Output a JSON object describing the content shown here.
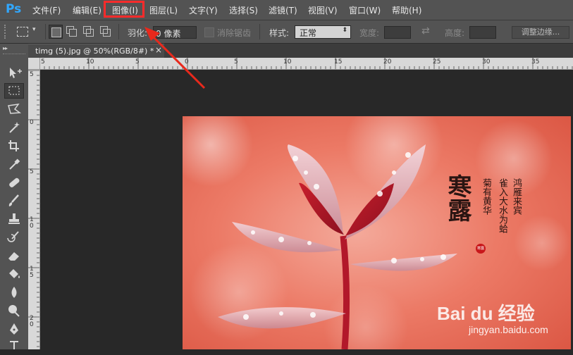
{
  "app": {
    "logo": "Ps"
  },
  "menu": {
    "items": [
      "文件(F)",
      "编辑(E)",
      "图像(I)",
      "图层(L)",
      "文字(Y)",
      "选择(S)",
      "滤镜(T)",
      "视图(V)",
      "窗口(W)",
      "帮助(H)"
    ],
    "highlighted": "图像(I)",
    "highlight_color": "#ff2b2b"
  },
  "options": {
    "feather_label": "羽化:",
    "feather_value": "0 像素",
    "antialias_label": "消除锯齿",
    "style_label": "样式:",
    "style_value": "正常",
    "width_label": "宽度:",
    "height_label": "高度:",
    "refine_edge_label": "调整边缘..."
  },
  "document": {
    "tab_title": "timg (5).jpg @ 50%(RGB/8#) *",
    "close_glyph": "×"
  },
  "rulers": {
    "horizontal_ticks": [
      "5",
      "10",
      "5",
      "0",
      "5",
      "10",
      "15",
      "20",
      "25",
      "30",
      "35"
    ],
    "vertical_ticks": [
      "5",
      "0",
      "5",
      "1 0",
      "1 5",
      "2 0"
    ]
  },
  "poster": {
    "title_chars": [
      "寒",
      "露"
    ],
    "line1": "鸿雁来宾",
    "line2": "雀入大水为蛤",
    "line3": "菊有黄华",
    "seal_text": "寒露"
  },
  "watermark": {
    "brand": "Bai du 经验",
    "url": "jingyan.baidu.com"
  },
  "tools": [
    "move-icon",
    "marquee-icon",
    "lasso-icon",
    "magic-wand-icon",
    "crop-icon",
    "eyedropper-icon",
    "healing-brush-icon",
    "brush-icon",
    "clone-stamp-icon",
    "history-brush-icon",
    "eraser-icon",
    "paint-bucket-icon",
    "blur-icon",
    "dodge-icon",
    "pen-icon"
  ]
}
